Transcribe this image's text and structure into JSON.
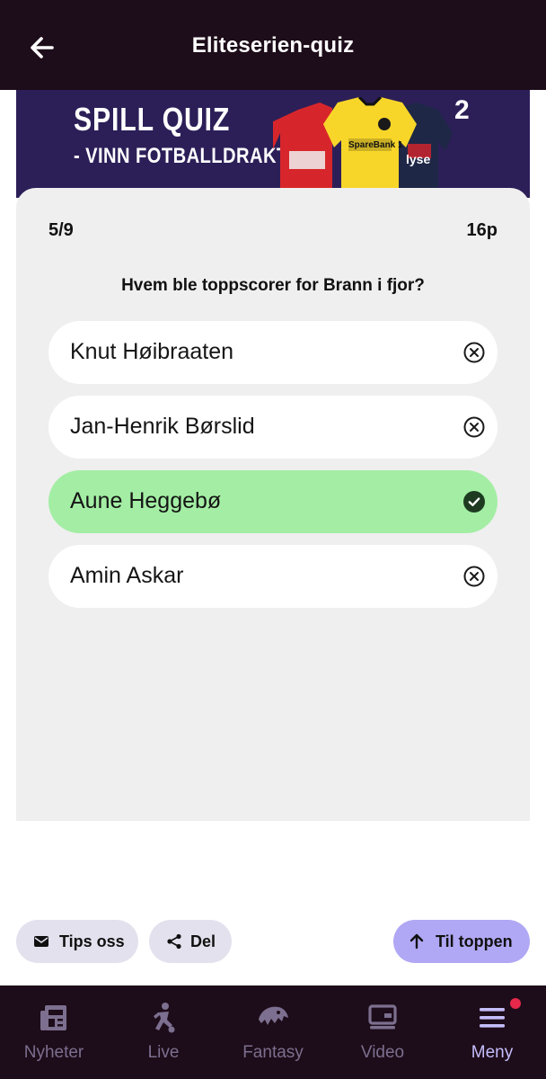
{
  "header": {
    "title": "Eliteserien-quiz",
    "back_icon": "arrow-left-icon"
  },
  "banner": {
    "line1": "SPILL QUIZ",
    "line2": "- VINN FOTBALLDRAKT!",
    "logo": "2"
  },
  "quiz": {
    "progress": "5/9",
    "score": "16p",
    "question": "Hvem ble toppscorer for Brann i fjor?",
    "options": [
      {
        "label": "Knut Høibraaten",
        "state": "wrong",
        "icon": "x-circle-icon"
      },
      {
        "label": "Jan-Henrik Børslid",
        "state": "wrong",
        "icon": "x-circle-icon"
      },
      {
        "label": "Aune Heggebø",
        "state": "correct",
        "icon": "check-circle-icon"
      },
      {
        "label": "Amin Askar",
        "state": "wrong",
        "icon": "x-circle-icon"
      }
    ],
    "correct_color": "#a3eea4"
  },
  "actions": {
    "tips": "Tips oss",
    "share": "Del",
    "to_top": "Til toppen"
  },
  "bottom_nav": {
    "items": [
      {
        "label": "Nyheter",
        "icon": "newspaper-icon"
      },
      {
        "label": "Live",
        "icon": "football-player-icon"
      },
      {
        "label": "Fantasy",
        "icon": "panther-icon"
      },
      {
        "label": "Video",
        "icon": "video-screen-icon"
      },
      {
        "label": "Meny",
        "icon": "menu-icon",
        "active": true,
        "notification": true
      }
    ]
  },
  "colors": {
    "header_bg": "#1d0c19",
    "banner_bg": "#2c1f58",
    "accent": "#b0a8f4",
    "nav_active": "#c4bdfb",
    "nav_inactive": "#7c6f8f"
  }
}
